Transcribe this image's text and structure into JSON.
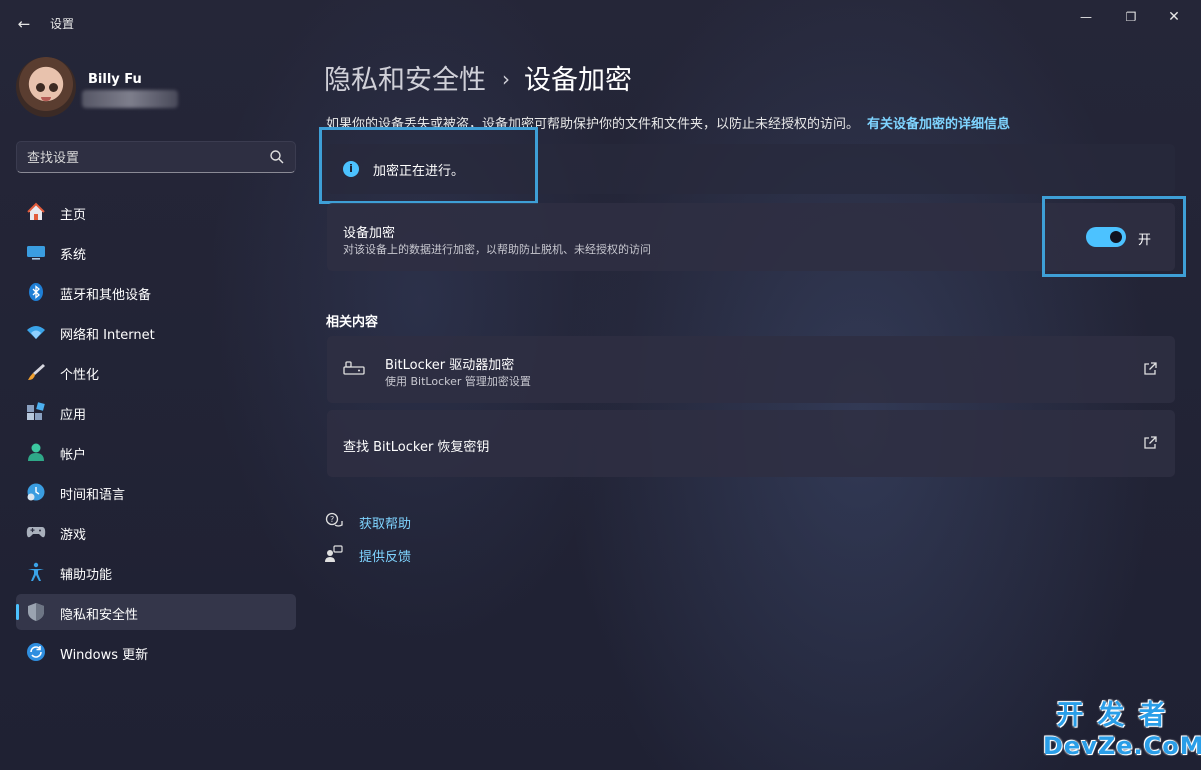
{
  "window": {
    "title": "设置",
    "back_icon": "back-arrow-icon",
    "controls": [
      "minimize-icon",
      "maximize-icon",
      "close-icon"
    ]
  },
  "user": {
    "name": "Billy Fu"
  },
  "search": {
    "placeholder": "查找设置",
    "icon": "search-icon"
  },
  "sidebar": {
    "items": [
      {
        "label": "主页",
        "icon": "home-icon",
        "active": false
      },
      {
        "label": "系统",
        "icon": "system-display-icon",
        "active": false
      },
      {
        "label": "蓝牙和其他设备",
        "icon": "bluetooth-icon",
        "active": false
      },
      {
        "label": "网络和 Internet",
        "icon": "wifi-icon",
        "active": false
      },
      {
        "label": "个性化",
        "icon": "brush-icon",
        "active": false
      },
      {
        "label": "应用",
        "icon": "apps-icon",
        "active": false
      },
      {
        "label": "帐户",
        "icon": "account-icon",
        "active": false
      },
      {
        "label": "时间和语言",
        "icon": "time-language-icon",
        "active": false
      },
      {
        "label": "游戏",
        "icon": "gamepad-icon",
        "active": false
      },
      {
        "label": "辅助功能",
        "icon": "accessibility-icon",
        "active": false
      },
      {
        "label": "隐私和安全性",
        "icon": "shield-icon",
        "active": true
      },
      {
        "label": "Windows 更新",
        "icon": "windows-update-icon",
        "active": false
      }
    ]
  },
  "breadcrumb": {
    "parent": "隐私和安全性",
    "separator": "›",
    "current": "设备加密"
  },
  "description": {
    "text": "如果你的设备丢失或被盗，设备加密可帮助保护你的文件和文件夹，以防止未经授权的访问。",
    "link": "有关设备加密的详细信息"
  },
  "info_bar": {
    "text": "加密正在进行。",
    "icon": "info-icon"
  },
  "device_encryption": {
    "title": "设备加密",
    "subtitle": "对该设备上的数据进行加密，以帮助防止脱机、未经授权的访问",
    "toggle_on": true,
    "toggle_label": "开"
  },
  "related": {
    "title": "相关内容",
    "items": [
      {
        "title": "BitLocker 驱动器加密",
        "subtitle": "使用 BitLocker 管理加密设置",
        "icon": "bitlocker-drive-icon",
        "action_icon": "external-link-icon"
      },
      {
        "title": "查找 BitLocker 恢复密钥",
        "action_icon": "external-link-icon"
      }
    ]
  },
  "help": {
    "get_help": "获取帮助",
    "feedback": "提供反馈"
  },
  "watermark": {
    "line1": "开发者",
    "line2": "DevZe.CoM"
  },
  "colors": {
    "accent": "#4cc2ff",
    "highlight_box": "#3e9fd6",
    "link": "#7fd4ff",
    "background": "#222436",
    "card": "#2e2f42"
  }
}
